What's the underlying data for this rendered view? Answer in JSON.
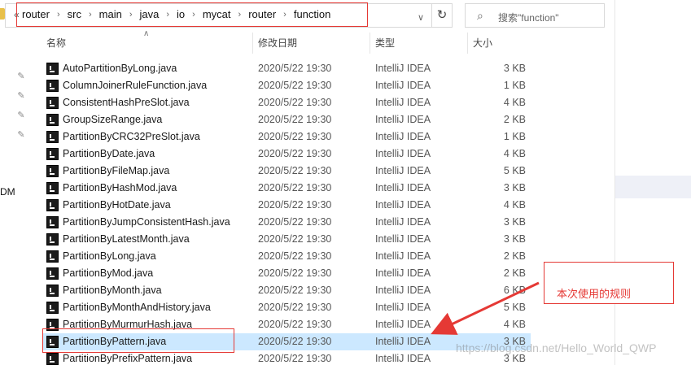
{
  "address_bar": {
    "overflow": "«",
    "crumbs": [
      "router",
      "src",
      "main",
      "java",
      "io",
      "mycat",
      "router",
      "function"
    ],
    "separator": "›",
    "dropdown_icon": "chevron-down-icon",
    "refresh_icon": "refresh-icon",
    "refresh_glyph": "↻"
  },
  "search": {
    "placeholder": "搜索\"function\"",
    "icon": "search-icon",
    "glyph": "⌕"
  },
  "nav": {
    "fragment_text": "DM",
    "pins": [
      "pin-icon",
      "pin-icon",
      "pin-icon",
      "pin-icon"
    ]
  },
  "columns": {
    "name": "名称",
    "date": "修改日期",
    "type": "类型",
    "size": "大小"
  },
  "files": [
    {
      "name": "AutoPartitionByLong.java",
      "date": "2020/5/22 19:30",
      "type": "IntelliJ IDEA",
      "size": "3 KB"
    },
    {
      "name": "ColumnJoinerRuleFunction.java",
      "date": "2020/5/22 19:30",
      "type": "IntelliJ IDEA",
      "size": "1 KB"
    },
    {
      "name": "ConsistentHashPreSlot.java",
      "date": "2020/5/22 19:30",
      "type": "IntelliJ IDEA",
      "size": "4 KB"
    },
    {
      "name": "GroupSizeRange.java",
      "date": "2020/5/22 19:30",
      "type": "IntelliJ IDEA",
      "size": "2 KB"
    },
    {
      "name": "PartitionByCRC32PreSlot.java",
      "date": "2020/5/22 19:30",
      "type": "IntelliJ IDEA",
      "size": "1 KB"
    },
    {
      "name": "PartitionByDate.java",
      "date": "2020/5/22 19:30",
      "type": "IntelliJ IDEA",
      "size": "4 KB"
    },
    {
      "name": "PartitionByFileMap.java",
      "date": "2020/5/22 19:30",
      "type": "IntelliJ IDEA",
      "size": "5 KB"
    },
    {
      "name": "PartitionByHashMod.java",
      "date": "2020/5/22 19:30",
      "type": "IntelliJ IDEA",
      "size": "3 KB"
    },
    {
      "name": "PartitionByHotDate.java",
      "date": "2020/5/22 19:30",
      "type": "IntelliJ IDEA",
      "size": "4 KB"
    },
    {
      "name": "PartitionByJumpConsistentHash.java",
      "date": "2020/5/22 19:30",
      "type": "IntelliJ IDEA",
      "size": "3 KB"
    },
    {
      "name": "PartitionByLatestMonth.java",
      "date": "2020/5/22 19:30",
      "type": "IntelliJ IDEA",
      "size": "3 KB"
    },
    {
      "name": "PartitionByLong.java",
      "date": "2020/5/22 19:30",
      "type": "IntelliJ IDEA",
      "size": "2 KB"
    },
    {
      "name": "PartitionByMod.java",
      "date": "2020/5/22 19:30",
      "type": "IntelliJ IDEA",
      "size": "2 KB"
    },
    {
      "name": "PartitionByMonth.java",
      "date": "2020/5/22 19:30",
      "type": "IntelliJ IDEA",
      "size": "6 KB"
    },
    {
      "name": "PartitionByMonthAndHistory.java",
      "date": "2020/5/22 19:30",
      "type": "IntelliJ IDEA",
      "size": "5 KB"
    },
    {
      "name": "PartitionByMurmurHash.java",
      "date": "2020/5/22 19:30",
      "type": "IntelliJ IDEA",
      "size": "4 KB"
    },
    {
      "name": "PartitionByPattern.java",
      "date": "2020/5/22 19:30",
      "type": "IntelliJ IDEA",
      "size": "3 KB",
      "selected": true
    },
    {
      "name": "PartitionByPrefixPattern.java",
      "date": "2020/5/22 19:30",
      "type": "IntelliJ IDEA",
      "size": "3 KB"
    }
  ],
  "annotation": {
    "text": "本次使用的规则"
  },
  "watermark": "https://blog.csdn.net/Hello_World_QWP",
  "colors": {
    "highlight_red": "#e53935",
    "selection_blue": "#cce8ff",
    "icon_dark": "#1b1b1b"
  }
}
